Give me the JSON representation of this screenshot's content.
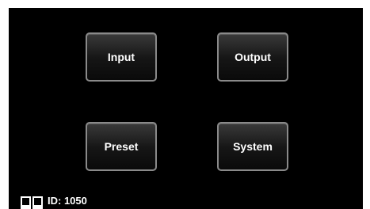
{
  "buttons": {
    "input": "Input",
    "output": "Output",
    "preset": "Preset",
    "system": "System"
  },
  "status": {
    "id_label": "ID: 1050",
    "icon": "dual-panel-icon"
  },
  "colors": {
    "screen_background": "#000000",
    "button_border": "#8a8a8a",
    "text": "#ffffff"
  }
}
